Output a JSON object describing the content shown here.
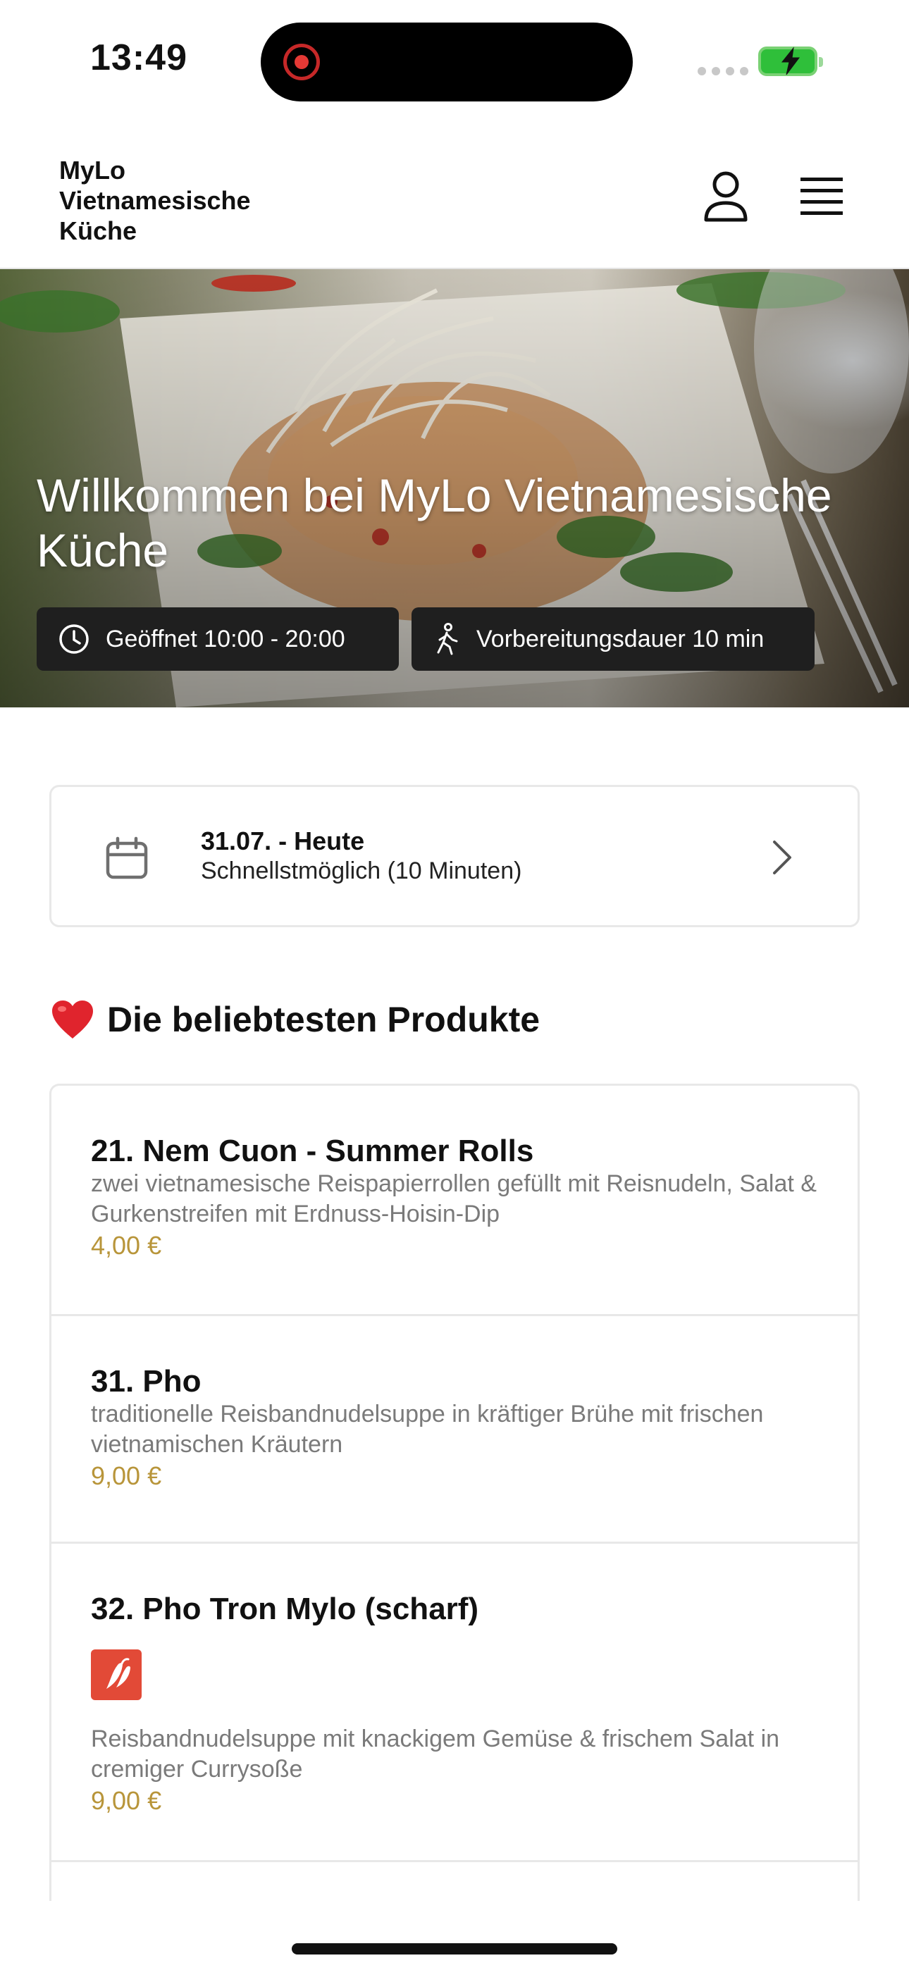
{
  "status_bar": {
    "time": "13:49",
    "recording_indicator": "record-icon",
    "battery_state": "charging",
    "colors": {
      "record": "#e53935",
      "battery": "#2fbf3a"
    }
  },
  "header": {
    "brand_name": "MyLo\nVietnamesische\nKüche",
    "icons": [
      "user-icon",
      "hamburger-menu-icon"
    ]
  },
  "hero": {
    "title": "Willkommen bei MyLo Vietnamesische Küche",
    "open_hours": "Geöffnet 10:00 - 20:00",
    "prep_time": "Vorbereitungsdauer 10 min",
    "icons": [
      "clock-icon",
      "walking-icon"
    ]
  },
  "order_time": {
    "date_label": "31.07. - Heute",
    "time_label": "Schnellstmöglich (10 Minuten)",
    "icons": [
      "calendar-icon",
      "chevron-right-icon"
    ]
  },
  "popular": {
    "heading": "Die beliebtesten Produkte",
    "heading_icon": "heart-icon",
    "products": [
      {
        "name": "21. Nem Cuon - Summer Rolls",
        "description": "zwei vietnamesische Reispapierrollen gefüllt mit Reisnudeln, Salat & Gurkenstreifen mit Erdnuss-Hoisin-Dip",
        "price": "4,00 €"
      },
      {
        "name": "31. Pho",
        "description": "traditionelle Reisbandnudelsuppe in kräftiger Brühe mit frischen vietnamischen Kräutern",
        "price": "9,00 €"
      },
      {
        "name": "32. Pho Tron Mylo (scharf)",
        "badge": "chili-pepper-icon",
        "description": "Reisbandnudelsuppe mit knackigem Gemüse & frischem Salat in cremiger Currysoße",
        "price": "9,00 €"
      }
    ]
  },
  "theme": {
    "price_color": "#b8953a",
    "chip_background": "#1f1f1f",
    "spicy_badge": "#e24a37"
  }
}
